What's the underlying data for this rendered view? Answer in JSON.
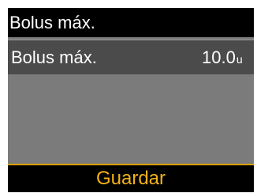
{
  "header": {
    "title": "Bolus máx."
  },
  "settings": {
    "row": {
      "label": "Bolus máx.",
      "value": "10.0",
      "unit": "u"
    }
  },
  "softkey": {
    "label": "Guardar"
  },
  "colors": {
    "title_bg": "#000000",
    "screen_bg": "#7b7b7b",
    "selected_row_bg": "#4b4b4b",
    "softkey_text": "#f2b21a",
    "softkey_border": "#d9a000"
  }
}
